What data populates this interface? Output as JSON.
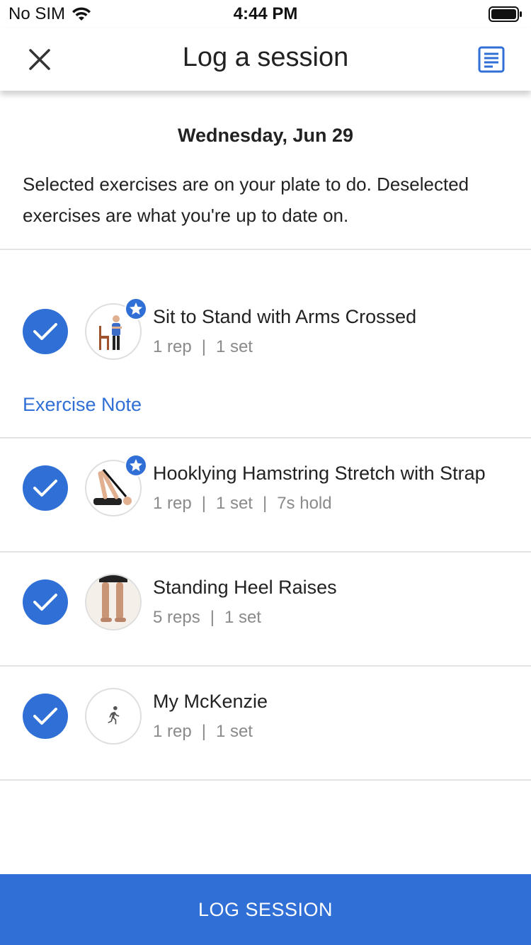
{
  "status_bar": {
    "carrier": "No SIM",
    "time": "4:44 PM"
  },
  "header": {
    "title": "Log a session",
    "close_icon": "close-icon",
    "notes_icon": "notes-icon"
  },
  "date": "Wednesday, Jun 29",
  "description": "Selected exercises are on your plate to do. Deselected exercises are what you're up to date on.",
  "exercise_note_label": "Exercise Note",
  "exercises": [
    {
      "name": "Sit to Stand with Arms Crossed",
      "reps": "1 rep",
      "sets": "1 set",
      "hold": "",
      "starred": true,
      "selected": true
    },
    {
      "name": "Hooklying Hamstring Stretch with Strap",
      "reps": "1 rep",
      "sets": "1 set",
      "hold": "7s hold",
      "starred": true,
      "selected": true
    },
    {
      "name": "Standing Heel Raises",
      "reps": "5 reps",
      "sets": "1 set",
      "hold": "",
      "starred": false,
      "selected": true
    },
    {
      "name": "My McKenzie",
      "reps": "1 rep",
      "sets": "1 set",
      "hold": "",
      "starred": false,
      "selected": true
    }
  ],
  "log_button_label": "LOG SESSION",
  "colors": {
    "accent": "#2f6fd6",
    "muted_text": "#8a8a8a",
    "divider": "#e3e3e3"
  }
}
